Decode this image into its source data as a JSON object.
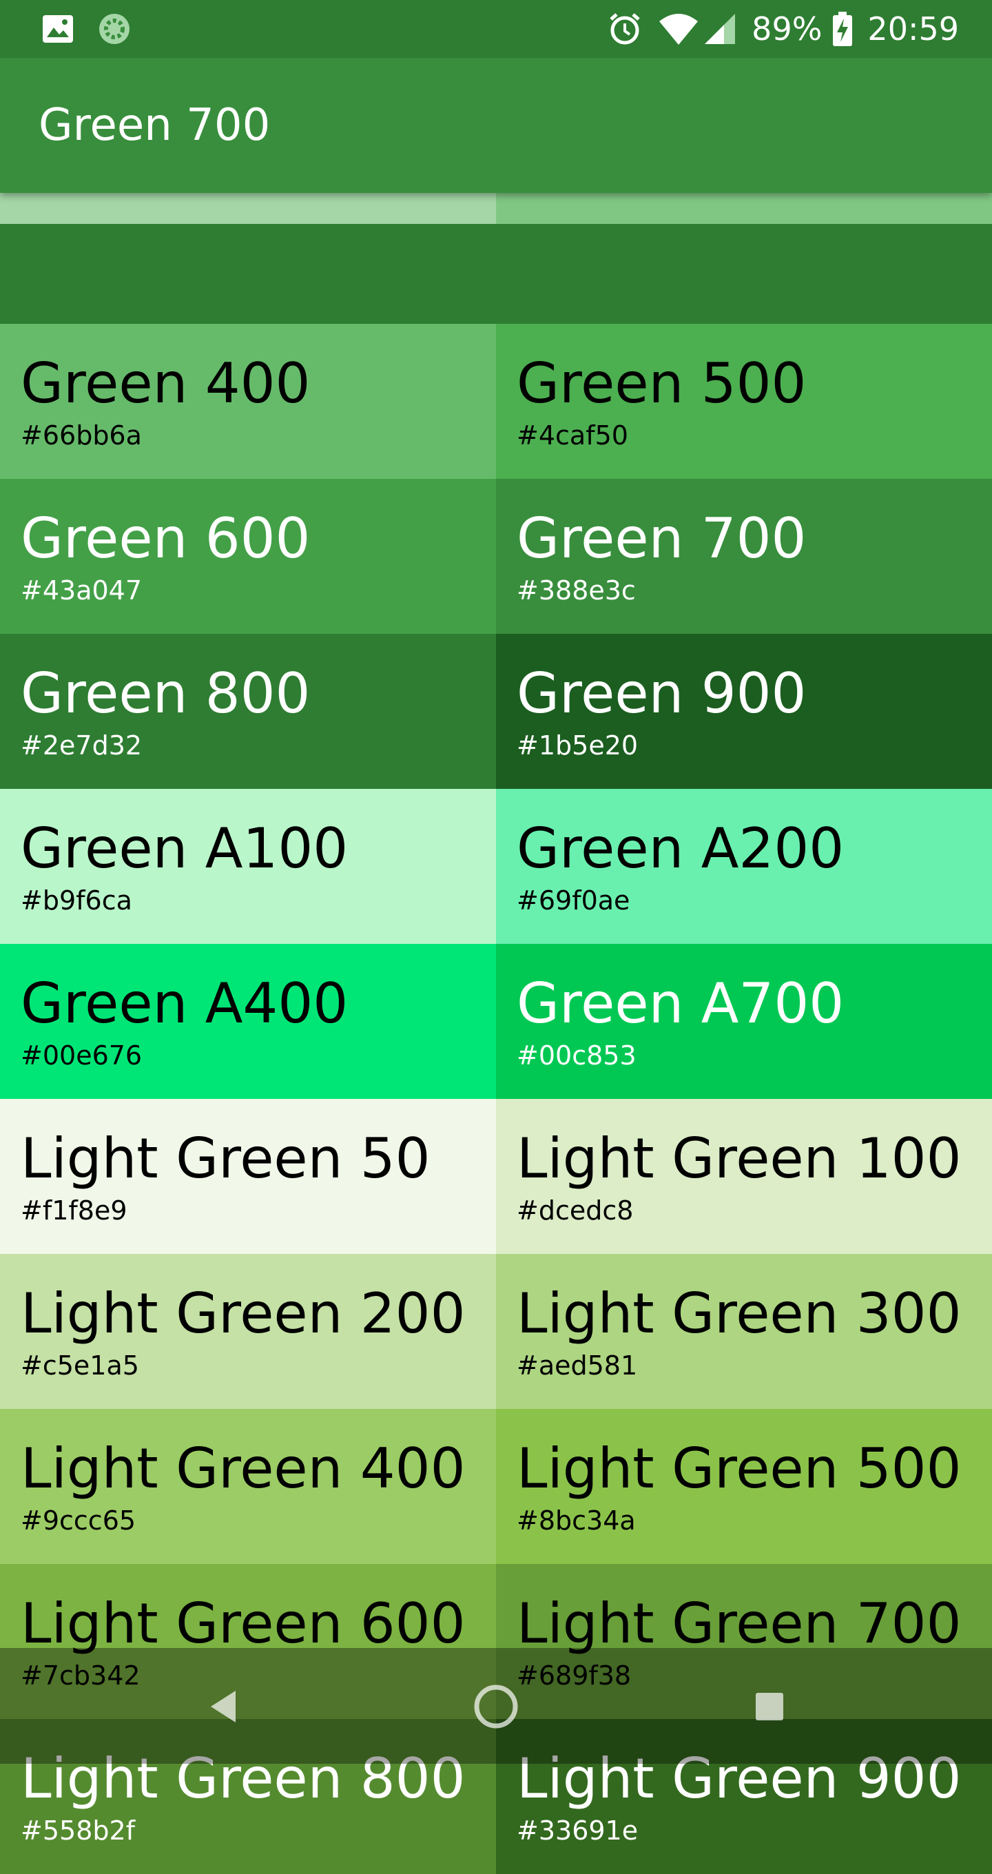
{
  "status_bar": {
    "left_icons": [
      "image-icon",
      "sync-icon"
    ],
    "right_icons": [
      "alarm-icon",
      "wifi-icon",
      "signal-icon",
      "battery-charging-icon"
    ],
    "battery_text": "89%",
    "time": "20:59"
  },
  "app_bar": {
    "title": "Green 700"
  },
  "partial_tiles": [
    {
      "hex": "#a5d6a7",
      "bg": "#a5d6a7",
      "fg": "#000000"
    },
    {
      "hex": "#81c784",
      "bg": "#81c784",
      "fg": "#000000"
    }
  ],
  "tiles": [
    {
      "name": "Green 400",
      "hex": "#66bb6a",
      "bg": "#66bb6a",
      "fg": "#000000"
    },
    {
      "name": "Green 500",
      "hex": "#4caf50",
      "bg": "#4caf50",
      "fg": "#000000"
    },
    {
      "name": "Green 600",
      "hex": "#43a047",
      "bg": "#43a047",
      "fg": "#ffffff"
    },
    {
      "name": "Green 700",
      "hex": "#388e3c",
      "bg": "#388e3c",
      "fg": "#ffffff"
    },
    {
      "name": "Green 800",
      "hex": "#2e7d32",
      "bg": "#2e7d32",
      "fg": "#ffffff"
    },
    {
      "name": "Green 900",
      "hex": "#1b5e20",
      "bg": "#1b5e20",
      "fg": "#ffffff"
    },
    {
      "name": "Green A100",
      "hex": "#b9f6ca",
      "bg": "#b9f6ca",
      "fg": "#000000"
    },
    {
      "name": "Green A200",
      "hex": "#69f0ae",
      "bg": "#69f0ae",
      "fg": "#000000"
    },
    {
      "name": "Green A400",
      "hex": "#00e676",
      "bg": "#00e676",
      "fg": "#000000"
    },
    {
      "name": "Green A700",
      "hex": "#00c853",
      "bg": "#00c853",
      "fg": "#ffffff"
    },
    {
      "name": "Light Green 50",
      "hex": "#f1f8e9",
      "bg": "#f1f8e9",
      "fg": "#000000"
    },
    {
      "name": "Light Green 100",
      "hex": "#dcedc8",
      "bg": "#dcedc8",
      "fg": "#000000"
    },
    {
      "name": "Light Green 200",
      "hex": "#c5e1a5",
      "bg": "#c5e1a5",
      "fg": "#000000"
    },
    {
      "name": "Light Green 300",
      "hex": "#aed581",
      "bg": "#aed581",
      "fg": "#000000"
    },
    {
      "name": "Light Green 400",
      "hex": "#9ccc65",
      "bg": "#9ccc65",
      "fg": "#000000"
    },
    {
      "name": "Light Green 500",
      "hex": "#8bc34a",
      "bg": "#8bc34a",
      "fg": "#000000"
    },
    {
      "name": "Light Green 600",
      "hex": "#7cb342",
      "bg": "#7cb342",
      "fg": "#000000"
    },
    {
      "name": "Light Green 700",
      "hex": "#689f38",
      "bg": "#689f38",
      "fg": "#000000"
    },
    {
      "name": "Light Green 800",
      "hex": "#558b2f",
      "bg": "#558b2f",
      "fg": "#ffffff"
    },
    {
      "name": "Light Green 900",
      "hex": "#33691e",
      "bg": "#33691e",
      "fg": "#ffffff"
    }
  ],
  "nav_bar": {
    "buttons": [
      "back-icon",
      "home-icon",
      "recents-icon"
    ]
  }
}
